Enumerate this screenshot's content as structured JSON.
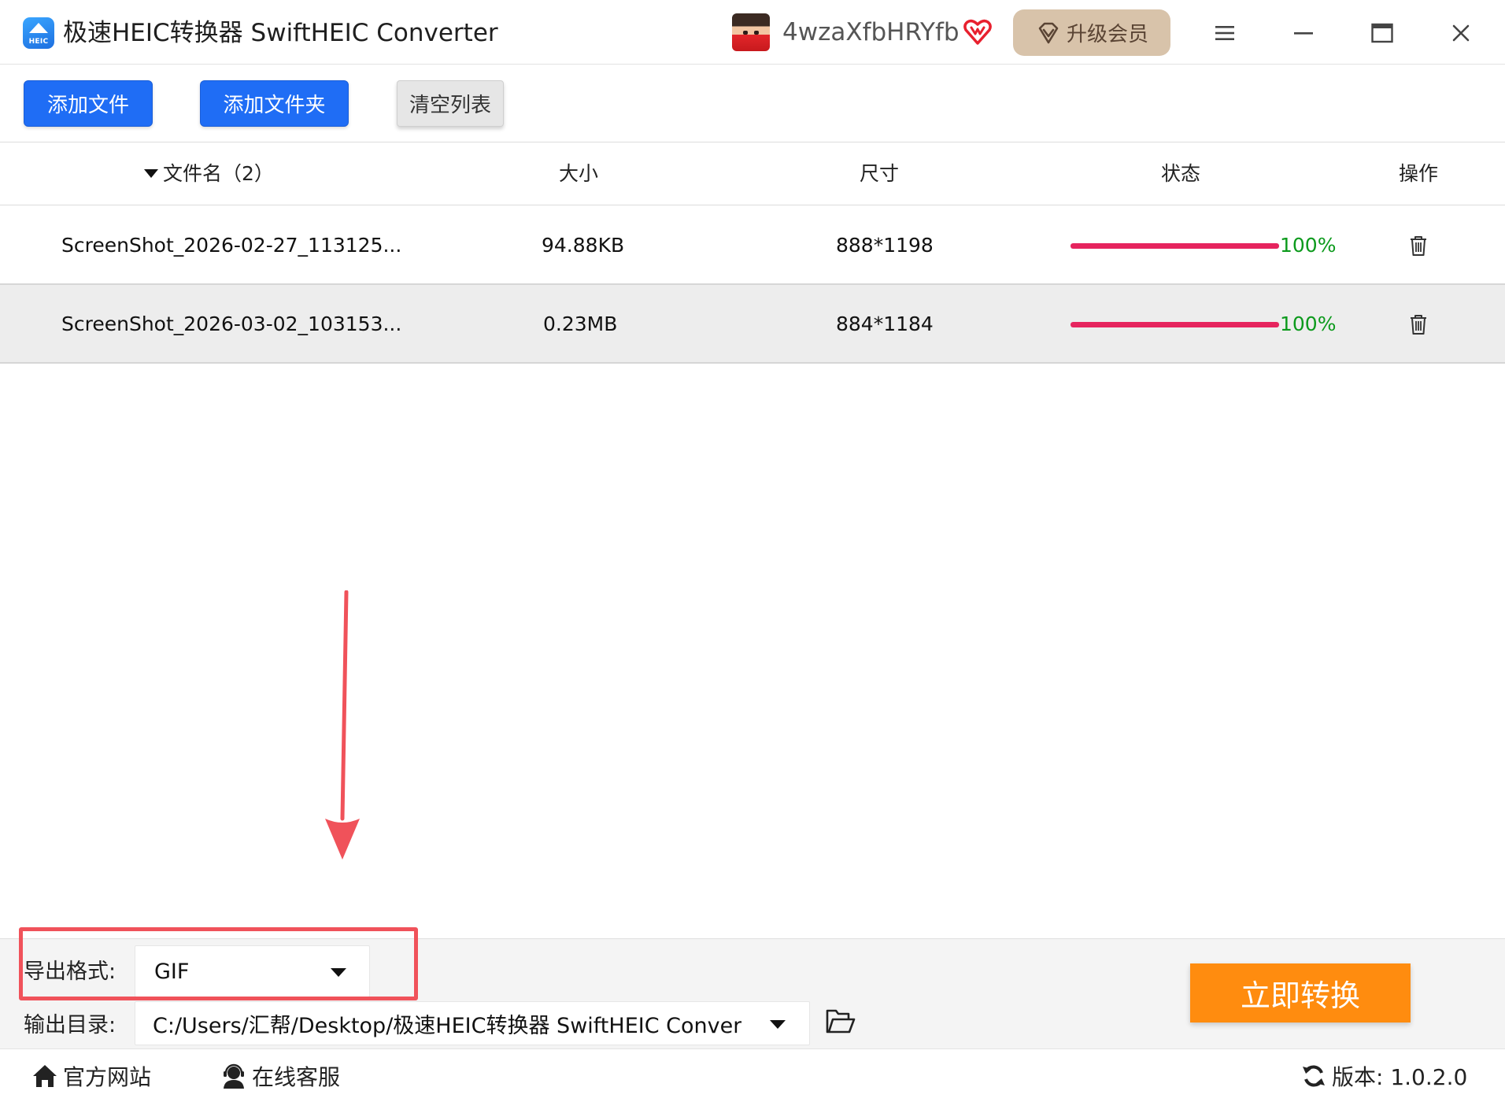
{
  "app": {
    "title": "极速HEIC转换器 SwiftHEIC Converter",
    "logo_text": "HEIC",
    "username": "4wzaXfbHRYfb",
    "upgrade_label": "升级会员",
    "icons": {
      "logo": "heic-logo-icon",
      "vip": "vip-heart-icon",
      "upgrade": "diamond-icon",
      "menu": "menu-icon",
      "minimize": "minimize-icon",
      "maximize": "maximize-icon",
      "close": "close-icon"
    }
  },
  "toolbar": {
    "add_file": "添加文件",
    "add_folder": "添加文件夹",
    "clear_list": "清空列表"
  },
  "table": {
    "headers": {
      "filename": "文件名（2）",
      "size": "大小",
      "dimensions": "尺寸",
      "status": "状态",
      "action": "操作"
    },
    "rows": [
      {
        "filename": "ScreenShot_2026-02-27_113125...",
        "size": "94.88KB",
        "dimensions": "888*1198",
        "progress": 100,
        "status": "100%"
      },
      {
        "filename": "ScreenShot_2026-03-02_103153...",
        "size": "0.23MB",
        "dimensions": "884*1184",
        "progress": 100,
        "status": "100%"
      }
    ]
  },
  "settings": {
    "format_label": "导出格式:",
    "format_value": "GIF",
    "output_label": "输出目录:",
    "output_value": "C:/Users/汇帮/Desktop/极速HEIC转换器 SwiftHEIC Conver",
    "convert_label": "立即转换"
  },
  "footer": {
    "website": "官方网站",
    "support": "在线客服",
    "version": "版本: 1.0.2.0"
  },
  "colors": {
    "primary_blue": "#1f6df5",
    "progress": "#e6245e",
    "status_green": "#0c9a1c",
    "convert_orange": "#ff8c0f",
    "highlight_red": "#f0525a",
    "upgrade_bg": "#d8c3aa"
  }
}
